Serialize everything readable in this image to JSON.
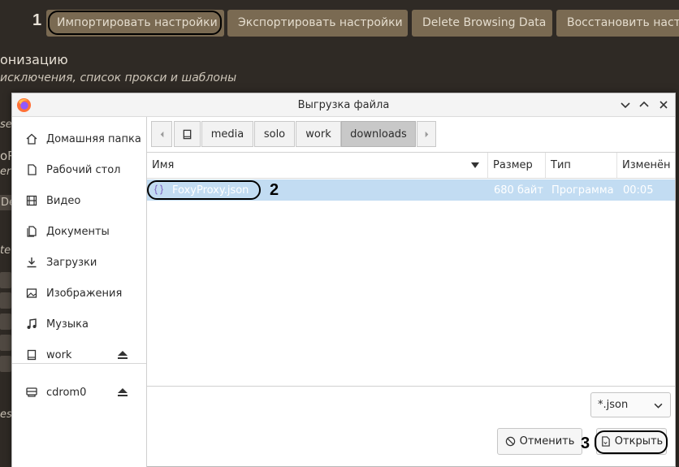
{
  "background": {
    "buttons": [
      {
        "label": "Импортировать настройки"
      },
      {
        "label": "Экспортировать настройки"
      },
      {
        "label": "Delete Browsing Data"
      },
      {
        "label": "Восстановить настр"
      }
    ],
    "heading": "онизацию",
    "subheading": "исключения, список прокси и шаблоны",
    "fragments": [
      "se",
      "oR",
      "er",
      "De",
      "te",
      "ess"
    ]
  },
  "annotations": {
    "step1": "1",
    "step2": "2",
    "step3": "3"
  },
  "dialog": {
    "title": "Выгрузка файла",
    "sidebar": [
      {
        "label": "Домашняя папка"
      },
      {
        "label": "Рабочий стол"
      },
      {
        "label": "Видео"
      },
      {
        "label": "Документы"
      },
      {
        "label": "Загрузки"
      },
      {
        "label": "Изображения"
      },
      {
        "label": "Музыка"
      },
      {
        "label": "work"
      },
      {
        "label": "cdrom0"
      }
    ],
    "path": [
      "media",
      "solo",
      "work",
      "downloads"
    ],
    "columns": {
      "name": "Имя",
      "size": "Размер",
      "type": "Тип",
      "modified": "Изменён"
    },
    "files": [
      {
        "name": "FoxyProxy.json",
        "size": "680 байт",
        "type": "Программа",
        "modified": "00:05"
      }
    ],
    "filter": {
      "selected": "*.json"
    },
    "buttons": {
      "cancel": "Отменить",
      "open": "Открыть"
    }
  }
}
